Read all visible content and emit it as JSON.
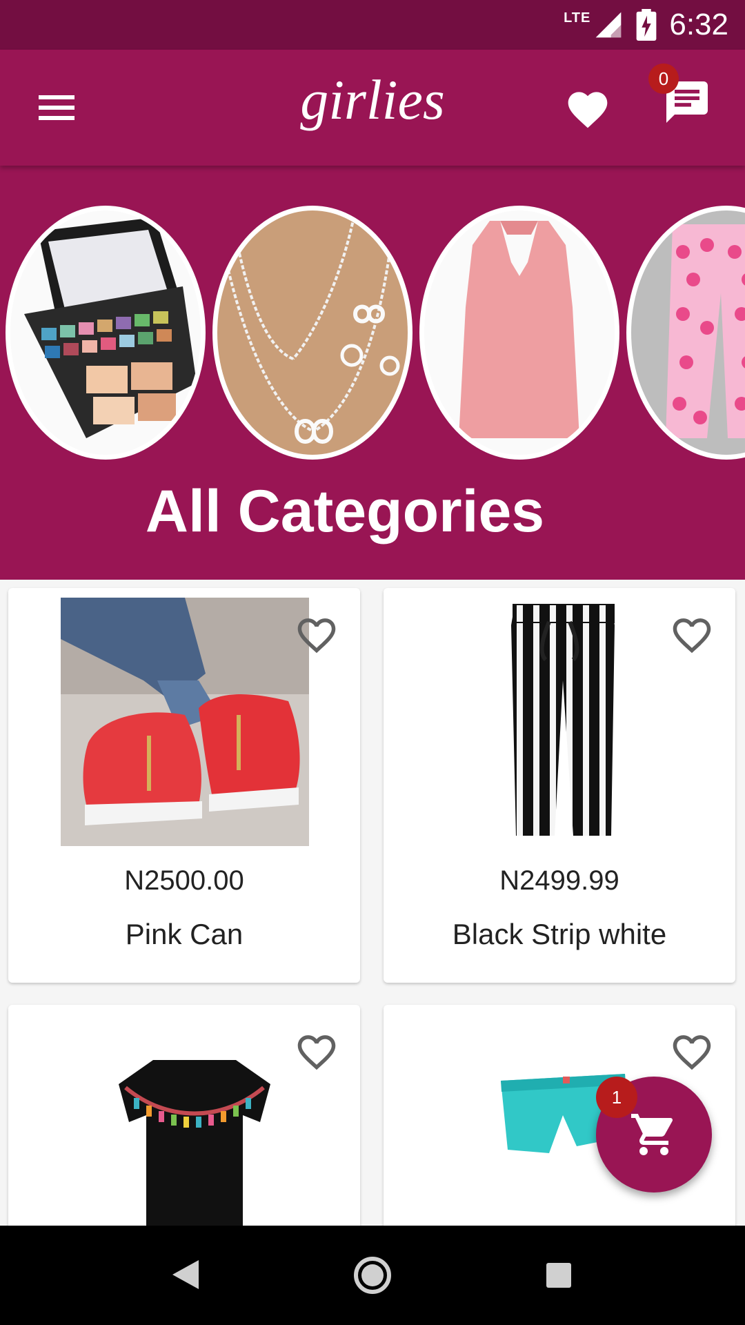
{
  "status_bar": {
    "network": "LTE",
    "time": "6:32"
  },
  "app_bar": {
    "logo": "girlies",
    "messages_count": "0"
  },
  "categories": {
    "title": "All Categories",
    "items": [
      {
        "icon": "makeup-palette-image"
      },
      {
        "icon": "necklace-jewelry-image"
      },
      {
        "icon": "pink-top-image"
      },
      {
        "icon": "polka-dot-pants-image"
      }
    ]
  },
  "products": [
    {
      "price": "N2500.00",
      "name": "Pink Can"
    },
    {
      "price": "N2499.99",
      "name": "Black Strip white"
    },
    {
      "price": "",
      "name": ""
    },
    {
      "price": "",
      "name": ""
    }
  ],
  "cart": {
    "count": "1"
  },
  "colors": {
    "primary": "#991554",
    "primary_dark": "#730E41",
    "badge": "#B71C1C"
  }
}
